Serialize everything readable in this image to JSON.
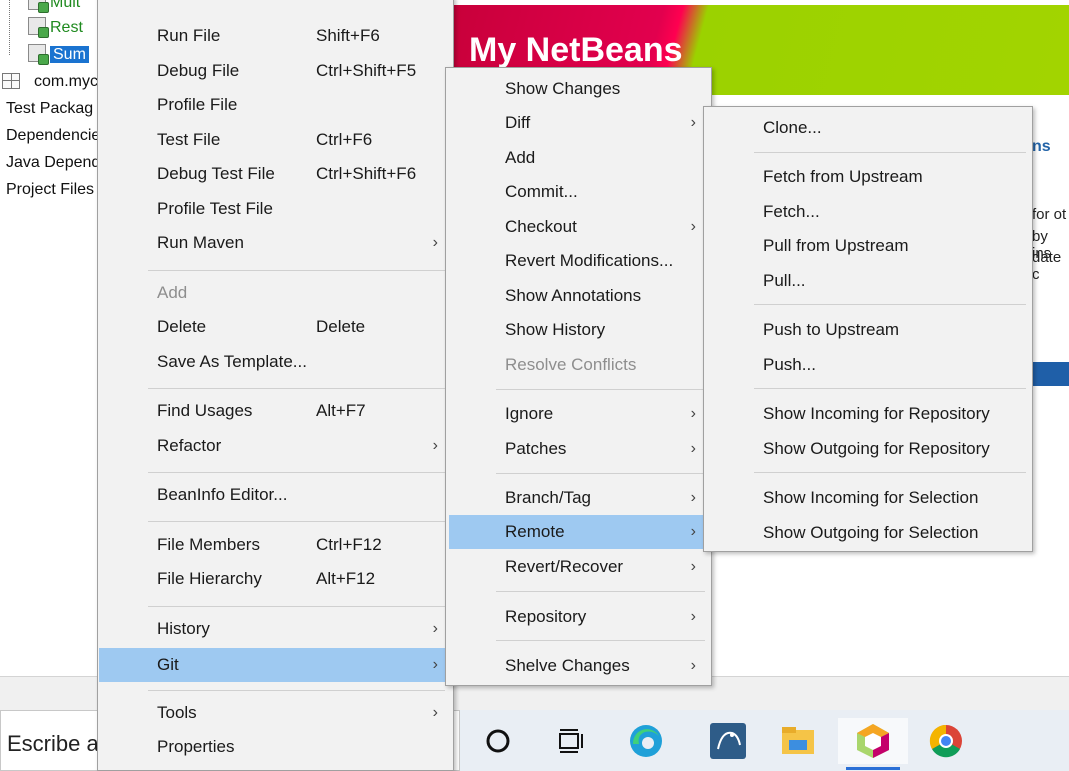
{
  "tree": {
    "items": [
      {
        "label": "Mult",
        "style": "green"
      },
      {
        "label": "Rest",
        "style": "green"
      },
      {
        "label": "Sum",
        "style": "selected"
      },
      {
        "label": "com.myc",
        "style": "package"
      },
      {
        "label": "Test Packag",
        "style": "plain"
      },
      {
        "label": "Dependencie",
        "style": "plain"
      },
      {
        "label": "Java Depend",
        "style": "plain"
      },
      {
        "label": "Project Files",
        "style": "plain"
      }
    ]
  },
  "welcome": {
    "title": "My NetBeans",
    "tab_fragment": "ns",
    "text_lines": [
      "for ot",
      "by ins",
      "date c"
    ]
  },
  "context_menu": {
    "items": [
      {
        "label": "Run File",
        "accel": "Shift+F6"
      },
      {
        "label": "Debug File",
        "accel": "Ctrl+Shift+F5"
      },
      {
        "label": "Profile File",
        "accel": ""
      },
      {
        "label": "Test File",
        "accel": "Ctrl+F6"
      },
      {
        "label": "Debug Test File",
        "accel": "Ctrl+Shift+F6"
      },
      {
        "label": "Profile Test File",
        "accel": ""
      },
      {
        "label": "Run Maven",
        "accel": ""
      },
      {
        "label": "Add",
        "accel": ""
      },
      {
        "label": "Delete",
        "accel": "Delete"
      },
      {
        "label": "Save As Template...",
        "accel": ""
      },
      {
        "label": "Find Usages",
        "accel": "Alt+F7"
      },
      {
        "label": "Refactor",
        "accel": ""
      },
      {
        "label": "BeanInfo Editor...",
        "accel": ""
      },
      {
        "label": "File Members",
        "accel": "Ctrl+F12"
      },
      {
        "label": "File Hierarchy",
        "accel": "Alt+F12"
      },
      {
        "label": "History",
        "accel": ""
      },
      {
        "label": "Git",
        "accel": ""
      },
      {
        "label": "Tools",
        "accel": ""
      },
      {
        "label": "Properties",
        "accel": ""
      }
    ]
  },
  "git_menu": {
    "items": [
      {
        "label": "Show Changes"
      },
      {
        "label": "Diff"
      },
      {
        "label": "Add"
      },
      {
        "label": "Commit..."
      },
      {
        "label": "Checkout"
      },
      {
        "label": "Revert Modifications..."
      },
      {
        "label": "Show Annotations"
      },
      {
        "label": "Show History"
      },
      {
        "label": "Resolve Conflicts"
      },
      {
        "label": "Ignore"
      },
      {
        "label": "Patches"
      },
      {
        "label": "Branch/Tag"
      },
      {
        "label": "Remote"
      },
      {
        "label": "Revert/Recover"
      },
      {
        "label": "Repository"
      },
      {
        "label": "Shelve Changes"
      }
    ]
  },
  "remote_menu": {
    "items": [
      {
        "label": "Clone..."
      },
      {
        "label": "Fetch from Upstream"
      },
      {
        "label": "Fetch..."
      },
      {
        "label": "Pull from Upstream"
      },
      {
        "label": "Pull..."
      },
      {
        "label": "Push to Upstream"
      },
      {
        "label": "Push..."
      },
      {
        "label": "Show Incoming for Repository"
      },
      {
        "label": "Show Outgoing for Repository"
      },
      {
        "label": "Show Incoming for Selection"
      },
      {
        "label": "Show Outgoing for Selection"
      }
    ]
  },
  "taskbar": {
    "search_placeholder": "Escribe a",
    "icons": [
      "cortana-icon",
      "task-view-icon",
      "edge-icon",
      "mysql-workbench-icon",
      "file-explorer-icon",
      "netbeans-icon",
      "chrome-icon"
    ]
  },
  "colors": {
    "menu_bg": "#f2f2f2",
    "highlight": "#9ec9f1",
    "selection": "#1a73d0",
    "banner_red": "#e2004e",
    "banner_green": "#a2d400"
  }
}
